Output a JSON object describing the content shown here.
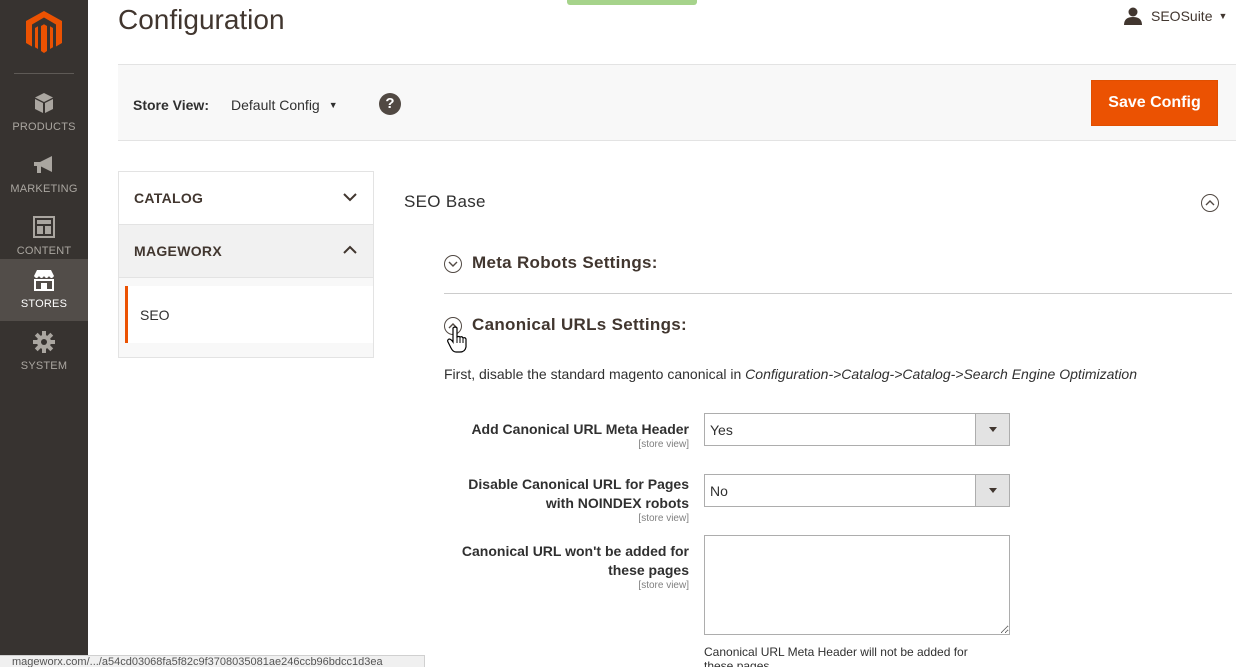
{
  "nav": {
    "items": [
      {
        "label": "PRODUCTS",
        "icon": "products-cube-icon"
      },
      {
        "label": "MARKETING",
        "icon": "marketing-megaphone-icon"
      },
      {
        "label": "CONTENT",
        "icon": "content-layout-icon"
      },
      {
        "label": "STORES",
        "icon": "stores-shop-icon"
      },
      {
        "label": "SYSTEM",
        "icon": "system-gear-icon"
      }
    ],
    "active": "STORES",
    "colors": {
      "background": "#373330",
      "active": "#524d49",
      "logo": "#eb5202"
    }
  },
  "header": {
    "title": "Configuration",
    "user": "SEOSuite"
  },
  "toolbar": {
    "store_view_label": "Store View:",
    "store_view_value": "Default Config",
    "help_glyph": "?",
    "save_label": "Save Config"
  },
  "tabs": {
    "catalog": "CATALOG",
    "mageworx": "MAGEWORX",
    "seo": "SEO"
  },
  "main": {
    "section_title": "SEO Base",
    "groups": {
      "meta_robots": "Meta Robots Settings:",
      "canonical": "Canonical URLs Settings:"
    },
    "note_prefix": "First, disable the standard magento canonical in ",
    "note_path": "Configuration->Catalog->Catalog->Search Engine Optimization",
    "fields": {
      "add_canonical": {
        "label": "Add Canonical URL Meta Header",
        "scope": "[store view]",
        "value": "Yes"
      },
      "disable_canonical": {
        "label_line1": "Disable Canonical URL for Pages",
        "label_line2": "with NOINDEX robots",
        "scope": "[store view]",
        "value": "No"
      },
      "canonical_excluded": {
        "label_line1": "Canonical URL won't be added for",
        "label_line2": "these pages",
        "scope": "[store view]",
        "value": ""
      }
    },
    "comment_line1": "Canonical URL Meta Header will not be added for",
    "comment_line2": "these pages"
  },
  "status_url": "mageworx.com/.../a54cd03068fa5f82c9f3708035081ae246ccb96bdcc1d3ea"
}
